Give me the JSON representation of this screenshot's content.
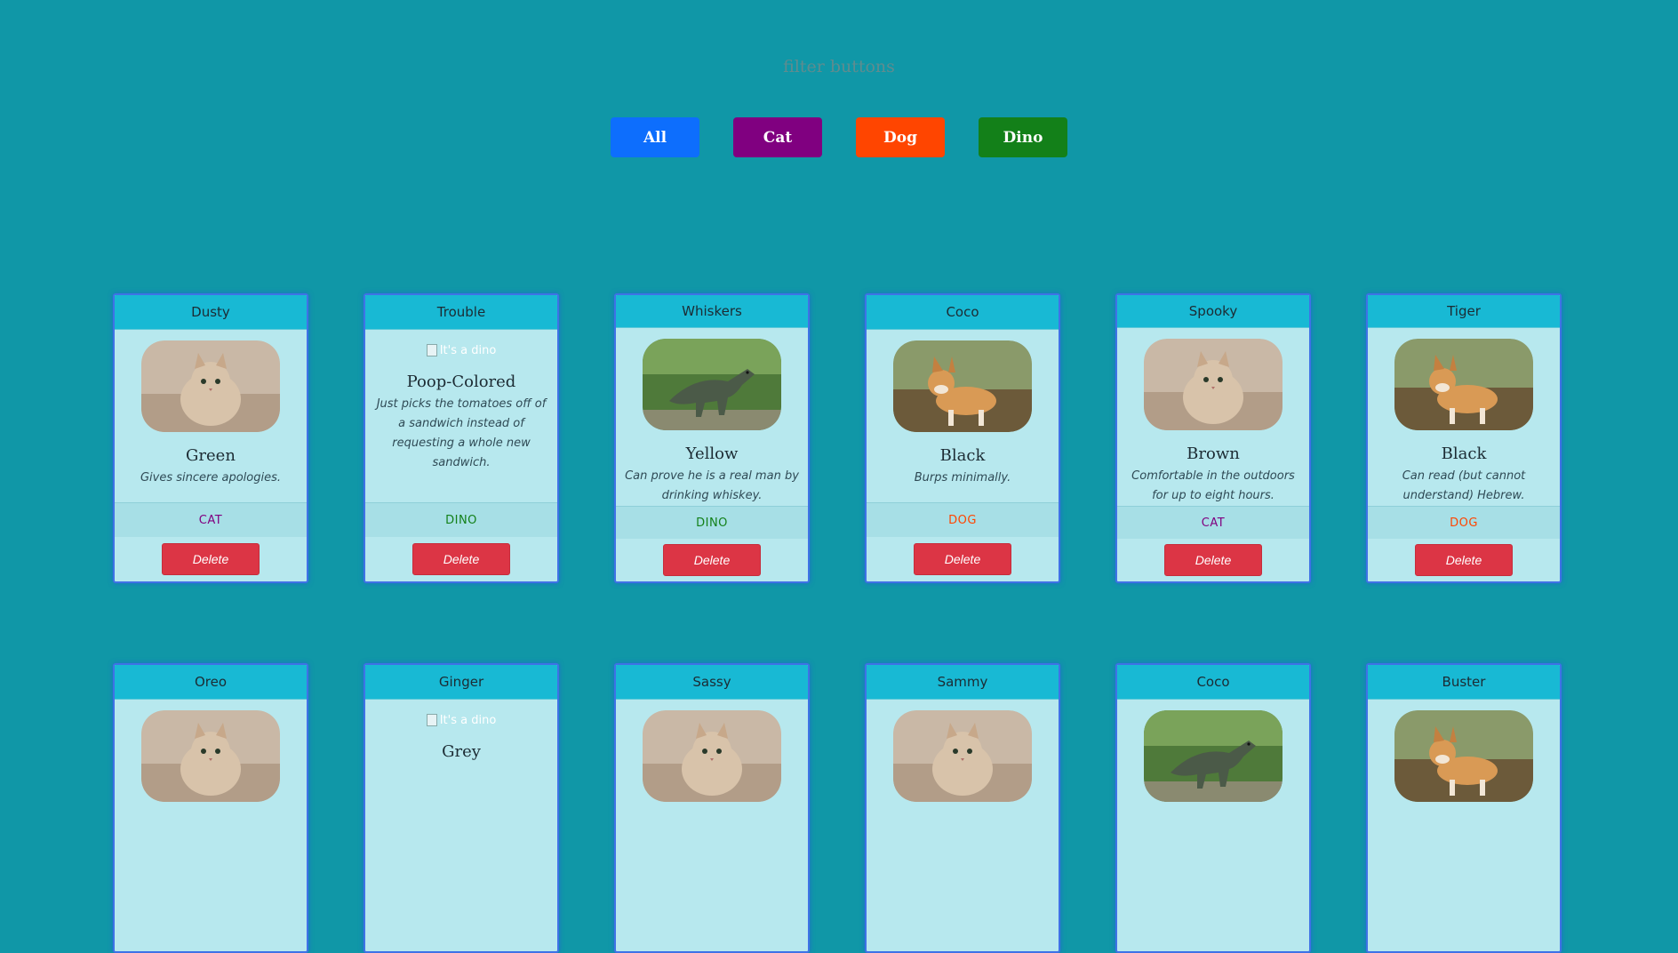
{
  "filter_heading": "filter buttons",
  "colors": {
    "all": "#0d6efd",
    "cat": "#800080",
    "dog": "#ff4500",
    "dino": "#138019"
  },
  "filters": [
    {
      "label": "All",
      "color": "#0d6efd"
    },
    {
      "label": "Cat",
      "color": "#800080"
    },
    {
      "label": "Dog",
      "color": "#ff4500"
    },
    {
      "label": "Dino",
      "color": "#138019"
    }
  ],
  "cards": [
    {
      "name": "Dusty",
      "image": "cat",
      "color": "Green",
      "special": "Gives sincere apologies.",
      "type": "CAT",
      "delete_label": "Delete"
    },
    {
      "name": "Trouble",
      "image": "broken",
      "alt": "It's a dino",
      "color": "Poop-Colored",
      "special": "Just picks the tomatoes off of a sandwich instead of requesting a whole new sandwich.",
      "type": "DINO",
      "delete_label": "Delete"
    },
    {
      "name": "Whiskers",
      "image": "dino",
      "color": "Yellow",
      "special": "Can prove he is a real man by drinking whiskey.",
      "type": "DINO",
      "delete_label": "Delete"
    },
    {
      "name": "Coco",
      "image": "dog",
      "color": "Black",
      "special": "Burps minimally.",
      "type": "DOG",
      "delete_label": "Delete"
    },
    {
      "name": "Spooky",
      "image": "cat",
      "color": "Brown",
      "special": "Comfortable in the outdoors for up to eight hours.",
      "type": "CAT",
      "delete_label": "Delete"
    },
    {
      "name": "Tiger",
      "image": "dog",
      "color": "Black",
      "special": "Can read (but cannot understand) Hebrew.",
      "type": "DOG",
      "delete_label": "Delete"
    },
    {
      "name": "Oreo",
      "image": "cat",
      "color": "",
      "special": "",
      "type": "",
      "delete_label": ""
    },
    {
      "name": "Ginger",
      "image": "broken",
      "alt": "It's a dino",
      "color": "Grey",
      "special": "",
      "type": "",
      "delete_label": ""
    },
    {
      "name": "Sassy",
      "image": "cat",
      "color": "",
      "special": "",
      "type": "",
      "delete_label": ""
    },
    {
      "name": "Sammy",
      "image": "cat",
      "color": "",
      "special": "",
      "type": "",
      "delete_label": ""
    },
    {
      "name": "Coco",
      "image": "dino",
      "color": "",
      "special": "",
      "type": "",
      "delete_label": ""
    },
    {
      "name": "Buster",
      "image": "dog",
      "color": "",
      "special": "",
      "type": "",
      "delete_label": ""
    }
  ],
  "type_colors": {
    "CAT": "#800080",
    "DOG": "#ff4500",
    "DINO": "#138019"
  }
}
